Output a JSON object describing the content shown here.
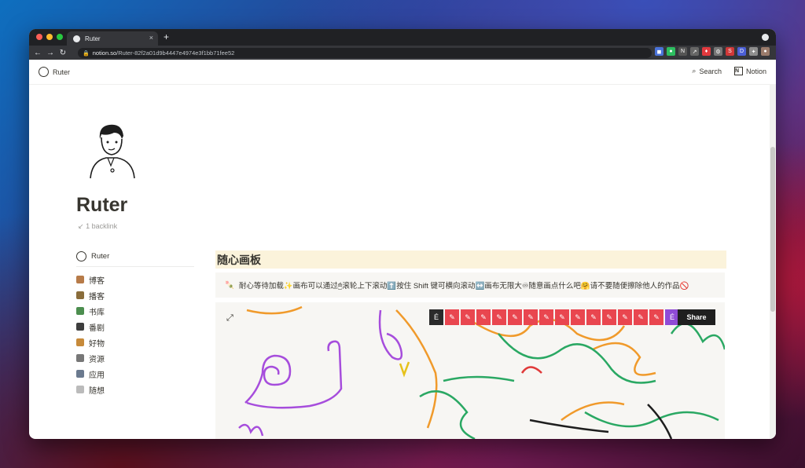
{
  "browser": {
    "tab_title": "Ruter",
    "tab_close": "×",
    "new_tab": "+",
    "url_host": "notion.so",
    "url_path": "/Ruter-82f2a01d9b4447e4974e3f1bb71fee52",
    "extensions": [
      {
        "icon": "bookmark-icon",
        "color": "#4a73d9",
        "glyph": "◼"
      },
      {
        "icon": "evernote-icon",
        "color": "#2dbe60",
        "glyph": "●"
      },
      {
        "icon": "notion-clipper-icon",
        "color": "#555555",
        "glyph": "N"
      },
      {
        "icon": "share-icon",
        "color": "#666666",
        "glyph": "↗"
      },
      {
        "icon": "pocket-icon",
        "color": "#e0393e",
        "glyph": "♦"
      },
      {
        "icon": "settings-icon",
        "color": "#777777",
        "glyph": "⚙"
      },
      {
        "icon": "s-extension-icon",
        "color": "#d03838",
        "glyph": "S"
      },
      {
        "icon": "d-extension-icon",
        "color": "#4b5fd6",
        "glyph": "D"
      },
      {
        "icon": "puzzle-icon",
        "color": "#8e8e8e",
        "glyph": "✦"
      },
      {
        "icon": "profile-icon",
        "color": "#9a7b6b",
        "glyph": "●"
      }
    ]
  },
  "notion": {
    "breadcrumb": "Ruter",
    "search_label": "Search",
    "notion_label": "Notion"
  },
  "page": {
    "title": "Ruter",
    "backlink": "1 backlink",
    "sidebar_title": "Ruter",
    "sidebar_items": [
      {
        "label": "博客",
        "color": "#b77b49"
      },
      {
        "label": "播客",
        "color": "#8a6d3b"
      },
      {
        "label": "书库",
        "color": "#4c8e4f"
      },
      {
        "label": "番剧",
        "color": "#3e3e3e"
      },
      {
        "label": "好物",
        "color": "#c78a3a"
      },
      {
        "label": "资源",
        "color": "#777777"
      },
      {
        "label": "应用",
        "color": "#6b7a8f"
      },
      {
        "label": "随想",
        "color": "#bbbbbb"
      }
    ],
    "heading": "随心画板",
    "callout": "耐心等待加载✨画布可以通过🖱滚轮上下滚动⬆️按住 Shift 键可横向滚动↔️画布无限大♾随意画点什么吧🤗请不要随便擦除他人的作品🚫",
    "toolbar_glyph": "É",
    "share_label": "Share"
  }
}
